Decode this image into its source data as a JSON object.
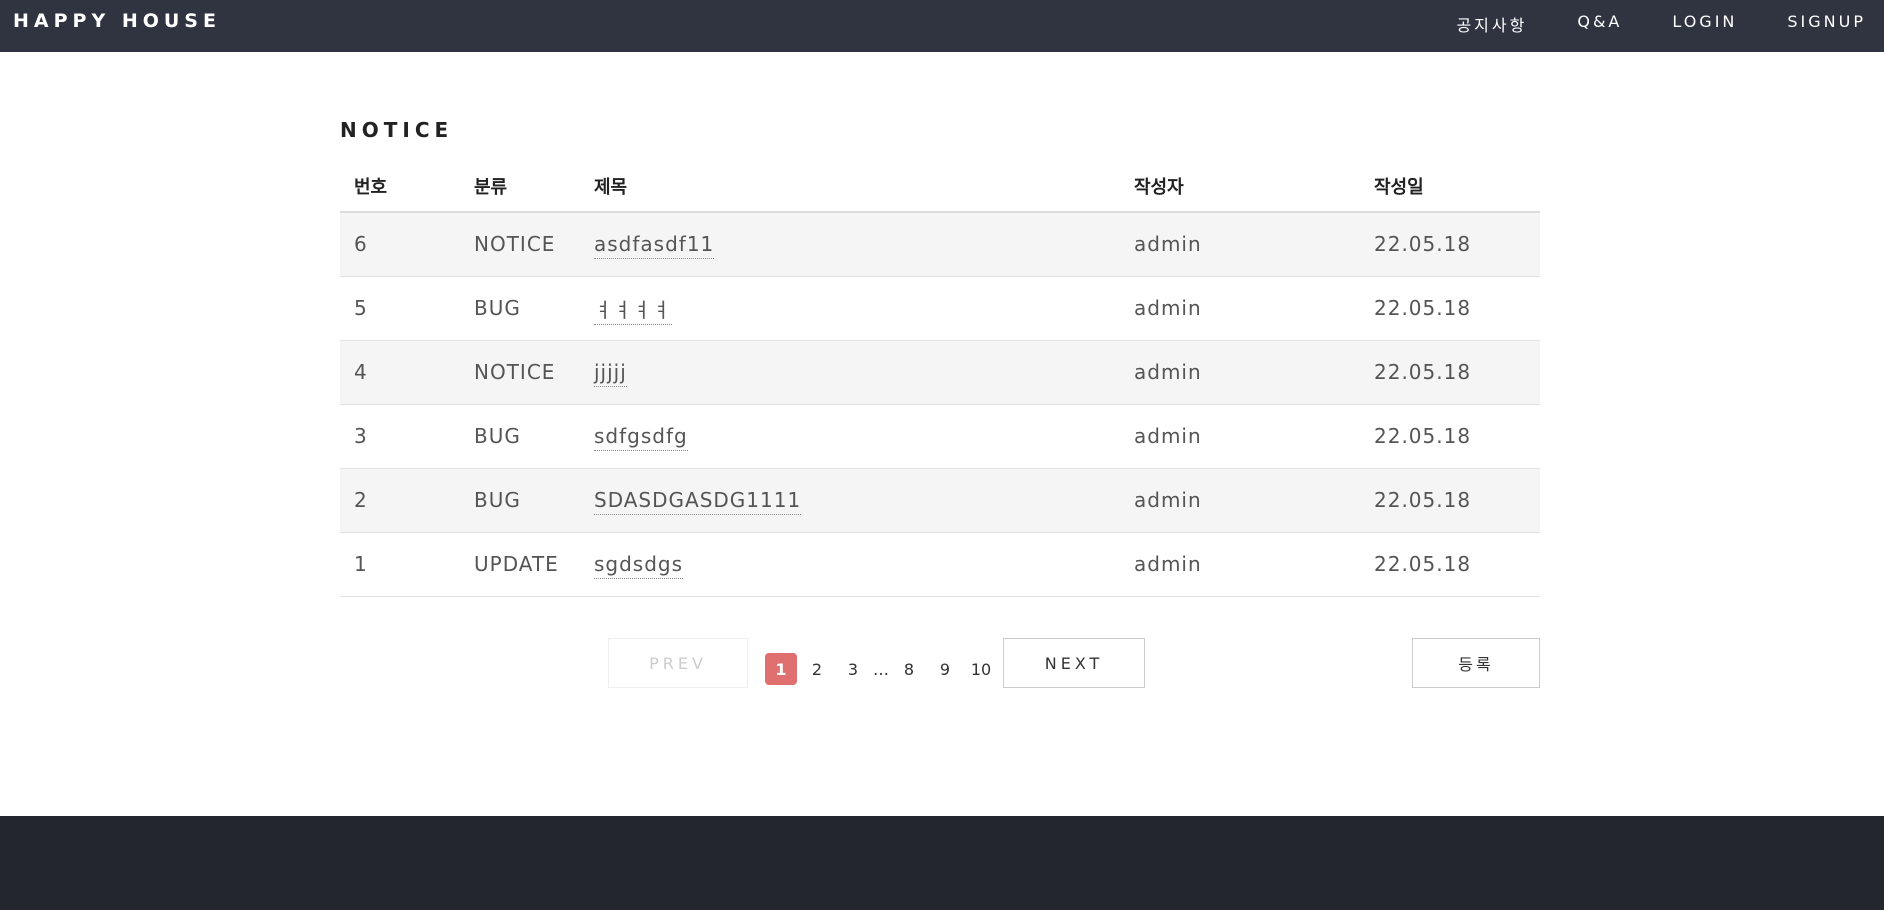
{
  "header": {
    "brand": "HAPPY HOUSE",
    "nav": [
      {
        "label": "공지사항"
      },
      {
        "label": "Q&A"
      },
      {
        "label": "LOGIN"
      },
      {
        "label": "SIGNUP"
      }
    ]
  },
  "notice": {
    "title": "NOTICE",
    "columns": {
      "no": "번호",
      "category": "분류",
      "title": "제목",
      "writer": "작성자",
      "date": "작성일"
    },
    "rows": [
      {
        "no": "6",
        "category": "NOTICE",
        "title": "asdfasdf11",
        "writer": "admin",
        "date": "22.05.18"
      },
      {
        "no": "5",
        "category": "BUG",
        "title": "ㅕㅕㅕㅕ",
        "writer": "admin",
        "date": "22.05.18"
      },
      {
        "no": "4",
        "category": "NOTICE",
        "title": "jjjjj",
        "writer": "admin",
        "date": "22.05.18"
      },
      {
        "no": "3",
        "category": "BUG",
        "title": "sdfgsdfg",
        "writer": "admin",
        "date": "22.05.18"
      },
      {
        "no": "2",
        "category": "BUG",
        "title": "SDASDGASDG1111",
        "writer": "admin",
        "date": "22.05.18"
      },
      {
        "no": "1",
        "category": "UPDATE",
        "title": "sgdsdgs",
        "writer": "admin",
        "date": "22.05.18"
      }
    ]
  },
  "pagination": {
    "prev_label": "PREV",
    "next_label": "NEXT",
    "pages": [
      "1",
      "2",
      "3",
      "8",
      "9",
      "10"
    ],
    "ellipsis": "…",
    "current": "1"
  },
  "actions": {
    "register_label": "등록"
  },
  "colors": {
    "topbar": "#2f3440",
    "footer": "#23262d",
    "active_page": "#e07070"
  }
}
